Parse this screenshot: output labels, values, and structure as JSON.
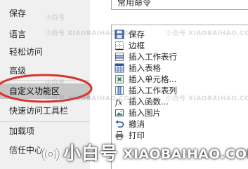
{
  "sidebar": {
    "items": [
      {
        "label": "保存"
      },
      {
        "label": "语言"
      },
      {
        "label": "轻松访问"
      },
      {
        "label": "高级"
      },
      {
        "label": "自定义功能区"
      },
      {
        "label": "快速访问工具栏"
      },
      {
        "label": "加载项"
      },
      {
        "label": "信任中心"
      }
    ],
    "selected_index": 4
  },
  "commands_dropdown": {
    "value": "常用命令"
  },
  "commands": [
    {
      "label": "保存",
      "icon": "save-icon"
    },
    {
      "label": "边框",
      "icon": "border-icon"
    },
    {
      "label": "插入工作表行",
      "icon": "insert-row-icon"
    },
    {
      "label": "插入表格",
      "icon": "insert-table-icon"
    },
    {
      "label": "插入单元格...",
      "icon": "insert-cells-icon"
    },
    {
      "label": "插入工作表列",
      "icon": "insert-column-icon"
    },
    {
      "label": "插入函数...",
      "icon": "function-icon"
    },
    {
      "label": "插入图片",
      "icon": "picture-icon"
    },
    {
      "label": "撤消",
      "icon": "undo-icon"
    },
    {
      "label": "打印",
      "icon": "print-icon"
    }
  ],
  "watermark": {
    "brand_cn": "小白号",
    "brand_en": "XIAOBAIHAO.COM",
    "stamp_cn": "小白号",
    "stamp_en": "XIAOBAIHAO.COM"
  },
  "colors": {
    "sidebar_bg": "#f0f0f0",
    "selected_bg": "#c6c6c6",
    "annotation_red": "#d9342b",
    "icon_blue": "#2b5797",
    "icon_green": "#2e8b57"
  }
}
